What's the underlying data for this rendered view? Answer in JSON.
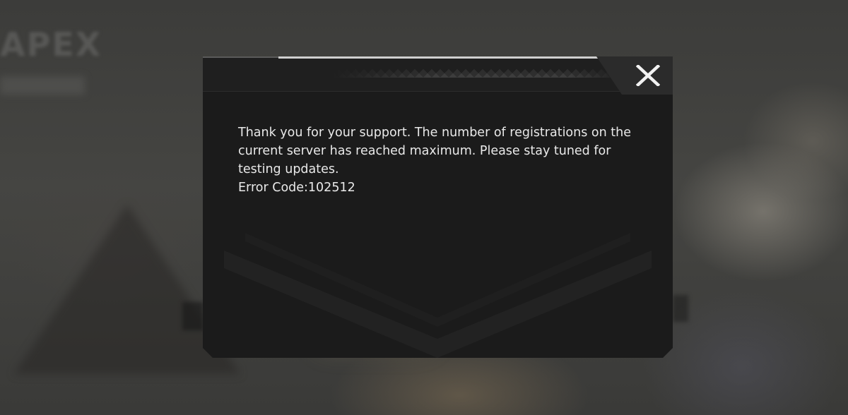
{
  "background": {
    "logo_text": "APEX"
  },
  "dialog": {
    "message_lines": [
      "Thank you for your support. The number of registrations on the",
      "current server has reached maximum. Please stay tuned for",
      "testing updates."
    ],
    "error_code": "Error Code:102512",
    "close_icon": "close-icon"
  },
  "colors": {
    "dialog_bg": "#1b1b1b",
    "text": "#e9e9e9",
    "accent_rim": "#cfcfcf"
  }
}
